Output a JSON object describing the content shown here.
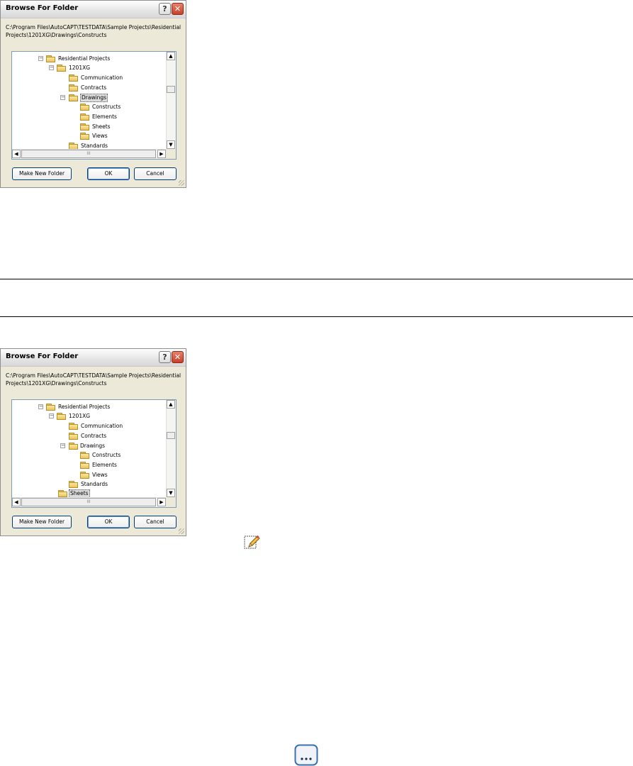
{
  "dialogs": [
    {
      "title": "Browse For Folder",
      "help_glyph": "?",
      "close_glyph": "✕",
      "path": "C:\\Program Files\\AutoCAPT\\TESTDATA\\Sample Projects\\Residential Projects\\1201XG\\Drawings\\Constructs",
      "tree": {
        "residential": "Residential Projects",
        "project": "1201XG",
        "communication": "Communication",
        "contracts": "Contracts",
        "drawings": "Drawings",
        "constructs": "Constructs",
        "elements": "Elements",
        "sheets": "Sheets",
        "views": "Views",
        "standards": "Standards"
      },
      "selected": "Drawings",
      "buttons": {
        "make_new": "Make New Folder",
        "ok": "OK",
        "cancel": "Cancel"
      }
    },
    {
      "title": "Browse For Folder",
      "help_glyph": "?",
      "close_glyph": "✕",
      "path": "C:\\Program Files\\AutoCAPT\\TESTDATA\\Sample Projects\\Residential Projects\\1201XG\\Drawings\\Constructs",
      "tree": {
        "residential": "Residential Projects",
        "project": "1201XG",
        "communication": "Communication",
        "contracts": "Contracts",
        "drawings": "Drawings",
        "constructs": "Constructs",
        "elements": "Elements",
        "views": "Views",
        "standards": "Standards",
        "sheets": "Sheets"
      },
      "selected": "Sheets",
      "buttons": {
        "make_new": "Make New Folder",
        "ok": "OK",
        "cancel": "Cancel"
      }
    }
  ],
  "scrollbar": {
    "up": "▲",
    "down": "▼",
    "left": "◀",
    "right": "▶",
    "grip": "III"
  },
  "icons": {
    "edit": "pencil-edit-icon",
    "browse": "ellipsis-browse-icon"
  },
  "colors": {
    "dialog_bg": "#ece9d8",
    "tree_border": "#7f9db9",
    "folder": "#eac45c",
    "close": "#c8402a"
  }
}
